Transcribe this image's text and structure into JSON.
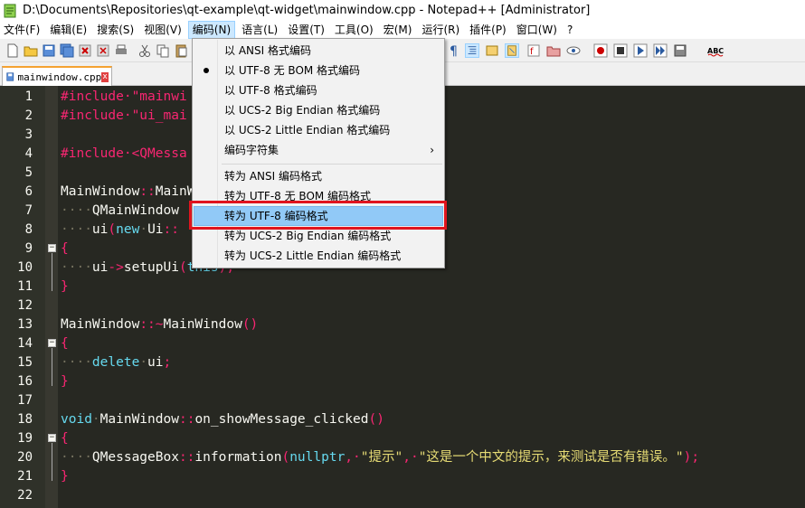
{
  "window": {
    "title": "D:\\Documents\\Repositories\\qt-example\\qt-widget\\mainwindow.cpp - Notepad++ [Administrator]"
  },
  "menubar": {
    "items": [
      {
        "label": "文件(F)"
      },
      {
        "label": "编辑(E)"
      },
      {
        "label": "搜索(S)"
      },
      {
        "label": "视图(V)"
      },
      {
        "label": "编码(N)"
      },
      {
        "label": "语言(L)"
      },
      {
        "label": "设置(T)"
      },
      {
        "label": "工具(O)"
      },
      {
        "label": "宏(M)"
      },
      {
        "label": "运行(R)"
      },
      {
        "label": "插件(P)"
      },
      {
        "label": "窗口(W)"
      },
      {
        "label": "?"
      }
    ]
  },
  "tab": {
    "label": "mainwindow.cpp",
    "close": "x"
  },
  "encoding_menu": {
    "items": [
      {
        "label": "以 ANSI 格式编码"
      },
      {
        "label": "以 UTF-8 无 BOM 格式编码",
        "checked": true
      },
      {
        "label": "以 UTF-8 格式编码"
      },
      {
        "label": "以 UCS-2 Big Endian 格式编码"
      },
      {
        "label": "以 UCS-2 Little Endian 格式编码"
      },
      {
        "label": "编码字符集",
        "submenu_arrow": "›"
      },
      {
        "label": "转为 ANSI 编码格式"
      },
      {
        "label": "转为 UTF-8 无 BOM 编码格式"
      },
      {
        "label": "转为 UTF-8 编码格式",
        "highlighted": true
      },
      {
        "label": "转为 UCS-2 Big Endian 编码格式"
      },
      {
        "label": "转为 UCS-2 Little Endian 编码格式"
      }
    ]
  },
  "editor": {
    "line_numbers": [
      "1",
      "2",
      "3",
      "4",
      "5",
      "6",
      "7",
      "8",
      "9",
      "10",
      "11",
      "12",
      "13",
      "14",
      "15",
      "16",
      "17",
      "18",
      "19",
      "20",
      "21",
      "22"
    ],
    "lines": {
      "l1_a": "#include·\"mainwi",
      "l2_a": "#include·\"ui_mai",
      "l4_a": "#include·<QMessa",
      "l6_a": "MainWindow",
      "l6_b": "::",
      "l6_c": "MainW",
      "l7_a": "····",
      "l7_b": "QMainWindow",
      "l8_a": "····",
      "l8_b": "ui",
      "l8_c": "(",
      "l8_d": "new",
      "l8_e": "·",
      "l8_f": "Ui",
      "l8_g": "::",
      "l9_a": "{",
      "l10_a": "····",
      "l10_b": "ui",
      "l10_c": "->",
      "l10_d": "setupUi",
      "l10_e": "(",
      "l10_f": "this",
      "l10_g": ");",
      "l11_a": "}",
      "l13_a": "MainWindow",
      "l13_b": "::~",
      "l13_c": "MainWindow",
      "l13_d": "()",
      "l14_a": "{",
      "l15_a": "····",
      "l15_b": "delete",
      "l15_c": "·",
      "l15_d": "ui",
      "l15_e": ";",
      "l16_a": "}",
      "l18_a": "void",
      "l18_b": "·",
      "l18_c": "MainWindow",
      "l18_d": "::",
      "l18_e": "on_showMessage_clicked",
      "l18_f": "()",
      "l19_a": "{",
      "l20_a": "····",
      "l20_b": "QMessageBox",
      "l20_c": "::",
      "l20_d": "information",
      "l20_e": "(",
      "l20_f": "nullptr",
      "l20_g": ",·",
      "l20_h": "\"提示\"",
      "l20_i": ",·",
      "l20_j": "\"这是一个中文的提示，来测试是否有错误。\"",
      "l20_k": ");",
      "l21_a": "}"
    }
  },
  "colors": {
    "editor_bg": "#272822",
    "keyword": "#66d9ef",
    "operator": "#f92672",
    "string": "#e6db74",
    "highlight": "#91c9f7",
    "annotation_box": "#e0141e"
  }
}
